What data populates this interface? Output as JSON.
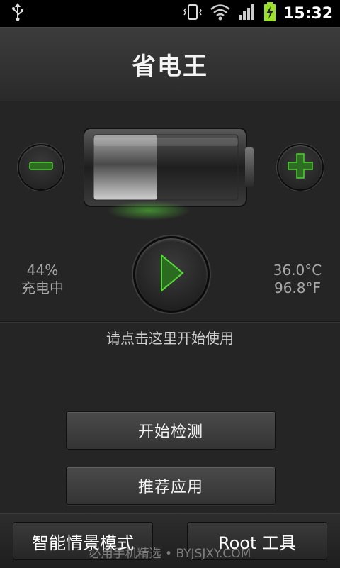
{
  "status_bar": {
    "time": "15:32",
    "icons": [
      "usb-icon",
      "vibrate-icon",
      "wifi-icon",
      "signal-icon",
      "battery-charging-icon"
    ]
  },
  "header": {
    "title": "省电王"
  },
  "battery": {
    "level_percent": 44,
    "level_text": "44%",
    "state_text": "充电中",
    "temp_c": "36.0°C",
    "temp_f": "96.8°F",
    "accent_color": "#39c22a"
  },
  "controls": {
    "minus_icon": "minus-icon",
    "plus_icon": "plus-icon",
    "play_icon": "play-icon"
  },
  "hint": "请点击这里开始使用",
  "buttons": {
    "start_check": "开始检测",
    "recommend_apps": "推荐应用"
  },
  "tabs": {
    "smart_mode": "智能情景模式",
    "root_tools": "Root 工具"
  },
  "watermark": "必用手机精选 • BYJSJXY.COM"
}
